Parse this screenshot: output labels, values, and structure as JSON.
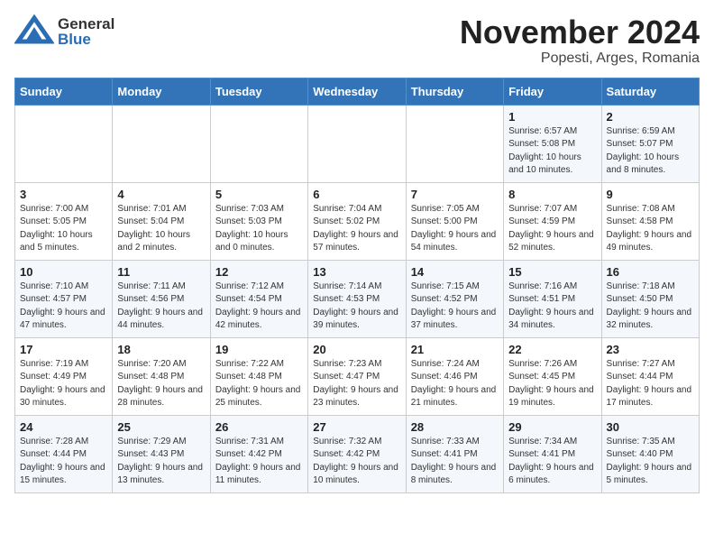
{
  "header": {
    "logo_general": "General",
    "logo_blue": "Blue",
    "month_title": "November 2024",
    "location": "Popesti, Arges, Romania"
  },
  "calendar": {
    "days_of_week": [
      "Sunday",
      "Monday",
      "Tuesday",
      "Wednesday",
      "Thursday",
      "Friday",
      "Saturday"
    ],
    "weeks": [
      [
        {
          "day": "",
          "info": ""
        },
        {
          "day": "",
          "info": ""
        },
        {
          "day": "",
          "info": ""
        },
        {
          "day": "",
          "info": ""
        },
        {
          "day": "",
          "info": ""
        },
        {
          "day": "1",
          "info": "Sunrise: 6:57 AM\nSunset: 5:08 PM\nDaylight: 10 hours and 10 minutes."
        },
        {
          "day": "2",
          "info": "Sunrise: 6:59 AM\nSunset: 5:07 PM\nDaylight: 10 hours and 8 minutes."
        }
      ],
      [
        {
          "day": "3",
          "info": "Sunrise: 7:00 AM\nSunset: 5:05 PM\nDaylight: 10 hours and 5 minutes."
        },
        {
          "day": "4",
          "info": "Sunrise: 7:01 AM\nSunset: 5:04 PM\nDaylight: 10 hours and 2 minutes."
        },
        {
          "day": "5",
          "info": "Sunrise: 7:03 AM\nSunset: 5:03 PM\nDaylight: 10 hours and 0 minutes."
        },
        {
          "day": "6",
          "info": "Sunrise: 7:04 AM\nSunset: 5:02 PM\nDaylight: 9 hours and 57 minutes."
        },
        {
          "day": "7",
          "info": "Sunrise: 7:05 AM\nSunset: 5:00 PM\nDaylight: 9 hours and 54 minutes."
        },
        {
          "day": "8",
          "info": "Sunrise: 7:07 AM\nSunset: 4:59 PM\nDaylight: 9 hours and 52 minutes."
        },
        {
          "day": "9",
          "info": "Sunrise: 7:08 AM\nSunset: 4:58 PM\nDaylight: 9 hours and 49 minutes."
        }
      ],
      [
        {
          "day": "10",
          "info": "Sunrise: 7:10 AM\nSunset: 4:57 PM\nDaylight: 9 hours and 47 minutes."
        },
        {
          "day": "11",
          "info": "Sunrise: 7:11 AM\nSunset: 4:56 PM\nDaylight: 9 hours and 44 minutes."
        },
        {
          "day": "12",
          "info": "Sunrise: 7:12 AM\nSunset: 4:54 PM\nDaylight: 9 hours and 42 minutes."
        },
        {
          "day": "13",
          "info": "Sunrise: 7:14 AM\nSunset: 4:53 PM\nDaylight: 9 hours and 39 minutes."
        },
        {
          "day": "14",
          "info": "Sunrise: 7:15 AM\nSunset: 4:52 PM\nDaylight: 9 hours and 37 minutes."
        },
        {
          "day": "15",
          "info": "Sunrise: 7:16 AM\nSunset: 4:51 PM\nDaylight: 9 hours and 34 minutes."
        },
        {
          "day": "16",
          "info": "Sunrise: 7:18 AM\nSunset: 4:50 PM\nDaylight: 9 hours and 32 minutes."
        }
      ],
      [
        {
          "day": "17",
          "info": "Sunrise: 7:19 AM\nSunset: 4:49 PM\nDaylight: 9 hours and 30 minutes."
        },
        {
          "day": "18",
          "info": "Sunrise: 7:20 AM\nSunset: 4:48 PM\nDaylight: 9 hours and 28 minutes."
        },
        {
          "day": "19",
          "info": "Sunrise: 7:22 AM\nSunset: 4:48 PM\nDaylight: 9 hours and 25 minutes."
        },
        {
          "day": "20",
          "info": "Sunrise: 7:23 AM\nSunset: 4:47 PM\nDaylight: 9 hours and 23 minutes."
        },
        {
          "day": "21",
          "info": "Sunrise: 7:24 AM\nSunset: 4:46 PM\nDaylight: 9 hours and 21 minutes."
        },
        {
          "day": "22",
          "info": "Sunrise: 7:26 AM\nSunset: 4:45 PM\nDaylight: 9 hours and 19 minutes."
        },
        {
          "day": "23",
          "info": "Sunrise: 7:27 AM\nSunset: 4:44 PM\nDaylight: 9 hours and 17 minutes."
        }
      ],
      [
        {
          "day": "24",
          "info": "Sunrise: 7:28 AM\nSunset: 4:44 PM\nDaylight: 9 hours and 15 minutes."
        },
        {
          "day": "25",
          "info": "Sunrise: 7:29 AM\nSunset: 4:43 PM\nDaylight: 9 hours and 13 minutes."
        },
        {
          "day": "26",
          "info": "Sunrise: 7:31 AM\nSunset: 4:42 PM\nDaylight: 9 hours and 11 minutes."
        },
        {
          "day": "27",
          "info": "Sunrise: 7:32 AM\nSunset: 4:42 PM\nDaylight: 9 hours and 10 minutes."
        },
        {
          "day": "28",
          "info": "Sunrise: 7:33 AM\nSunset: 4:41 PM\nDaylight: 9 hours and 8 minutes."
        },
        {
          "day": "29",
          "info": "Sunrise: 7:34 AM\nSunset: 4:41 PM\nDaylight: 9 hours and 6 minutes."
        },
        {
          "day": "30",
          "info": "Sunrise: 7:35 AM\nSunset: 4:40 PM\nDaylight: 9 hours and 5 minutes."
        }
      ]
    ]
  }
}
